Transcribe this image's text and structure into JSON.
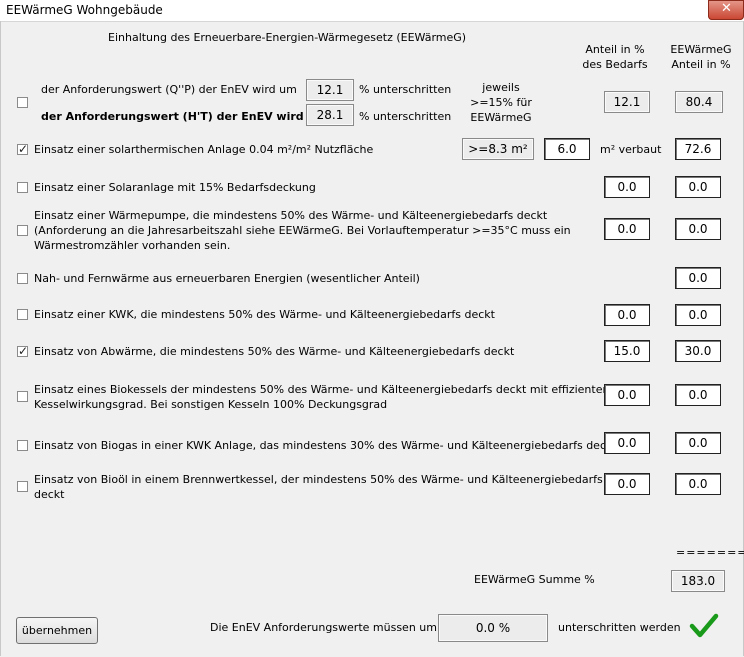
{
  "window": {
    "title": "EEWärmeG Wohngebäude",
    "close_symbol": "✕"
  },
  "header": {
    "main_title": "Einhaltung des Erneuerbare-Energien-Wärmegesetz (EEWärmeG)",
    "col1_line1": "Anteil in %",
    "col1_line2": "des Bedarfs",
    "col2_line1": "EEWärmeG",
    "col2_line2": "Anteil in %"
  },
  "enev_row": {
    "checked": false,
    "line1_label": "der Anforderungswert (Q''P) der EnEV wird um",
    "line1_value": "12.1",
    "line1_suffix": "% unterschritten",
    "line2_label": "der Anforderungswert (H'T) der EnEV wird um",
    "line2_value": "28.1",
    "line2_suffix": "% unterschritten",
    "note_line1": "jeweils",
    "note_line2": ">=15% für",
    "note_line3": "EEWärmeG",
    "anteil_bedarf": "12.1",
    "anteil_eewaermeg": "80.4"
  },
  "solar_thermal_row": {
    "checked": true,
    "label": "Einsatz einer solarthermischen Anlage  0.04 m²/m² Nutzfläche",
    "requirement": ">=8.3 m²",
    "area_value": "6.0",
    "area_suffix": "m² verbaut",
    "anteil_eewaermeg": "72.6"
  },
  "rows": [
    {
      "key": "solaranlage",
      "checked": false,
      "lines": [
        "Einsatz einer Solaranlage mit 15% Bedarfsdeckung"
      ],
      "anteil_bedarf": "0.0",
      "anteil_eewaermeg": "0.0"
    },
    {
      "key": "waermepumpe",
      "checked": false,
      "lines": [
        "Einsatz einer Wärmepumpe, die mindestens 50% des Wärme- und Kälteenergiebedarfs deckt",
        "(Anforderung an die Jahresarbeitszahl siehe EEWärmeG. Bei Vorlauftemperatur >=35°C muss ein",
        "Wärmestromzähler vorhanden sein."
      ],
      "anteil_bedarf": "0.0",
      "anteil_eewaermeg": "0.0"
    },
    {
      "key": "fernwaerme",
      "checked": false,
      "lines": [
        "Nah- und Fernwärme aus erneuerbaren Energien (wesentlicher Anteil)"
      ],
      "anteil_bedarf": null,
      "anteil_eewaermeg": "0.0"
    },
    {
      "key": "kwk",
      "checked": false,
      "lines": [
        "Einsatz einer KWK, die mindestens 50% des Wärme- und Kälteenergiebedarfs deckt"
      ],
      "anteil_bedarf": "0.0",
      "anteil_eewaermeg": "0.0"
    },
    {
      "key": "abwaerme",
      "checked": true,
      "lines": [
        "Einsatz von Abwärme, die mindestens 50% des Wärme- und Kälteenergiebedarfs deckt"
      ],
      "anteil_bedarf": "15.0",
      "anteil_eewaermeg": "30.0"
    },
    {
      "key": "biokessel",
      "checked": false,
      "lines": [
        "Einsatz eines Biokessels der mindestens 50% des Wärme- und Kälteenergiebedarfs deckt mit effizienten",
        "Kesselwirkungsgrad. Bei sonstigen Kesseln 100% Deckungsgrad"
      ],
      "anteil_bedarf": "0.0",
      "anteil_eewaermeg": "0.0"
    },
    {
      "key": "biogas",
      "checked": false,
      "lines": [
        "Einsatz von Biogas in einer KWK Anlage, das mindestens 30% des Wärme- und Kälteenergiebedarfs deckt"
      ],
      "anteil_bedarf": "0.0",
      "anteil_eewaermeg": "0.0"
    },
    {
      "key": "biooel",
      "checked": false,
      "lines": [
        "Einsatz von Bioöl in einem Brennwertkessel, der mindestens 50% des Wärme- und Kälteenergiebedarfs",
        "deckt"
      ],
      "anteil_bedarf": "0.0",
      "anteil_eewaermeg": "0.0"
    }
  ],
  "summary": {
    "separator": "=======",
    "sum_label": "EEWärmeG Summe %",
    "sum_value": "183.0"
  },
  "footer": {
    "apply_button": "übernehmen",
    "enev_text_before": "Die EnEV Anforderungswerte müssen um",
    "enev_value": "0.0 %",
    "enev_text_after": "unterschritten werden",
    "status_icon": "check-icon",
    "status_color": "#1a9a1a"
  }
}
